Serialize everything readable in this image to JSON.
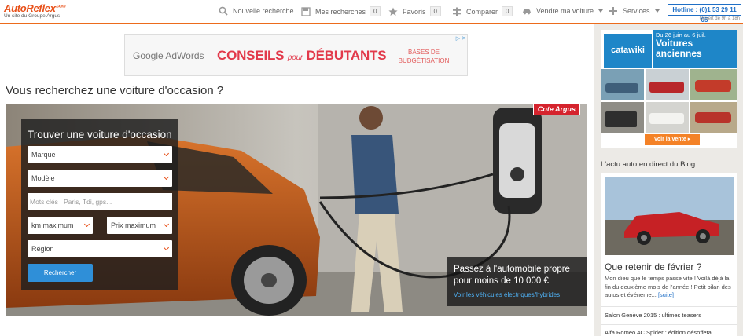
{
  "header": {
    "brand": "AutoReflex",
    "brand_sup": ".com",
    "tagline": "Un site du Groupe Argus",
    "nav": [
      {
        "label": "Nouvelle recherche",
        "icon": "search-icon"
      },
      {
        "label": "Mes recherches",
        "icon": "saved-search-icon",
        "count": "0"
      },
      {
        "label": "Favoris",
        "icon": "star-icon",
        "count": "0"
      },
      {
        "label": "Comparer",
        "icon": "compare-icon",
        "count": "0"
      },
      {
        "label": "Vendre ma voiture",
        "icon": "car-icon"
      },
      {
        "label": "Services",
        "icon": "plus-icon"
      }
    ],
    "hotline": "Hotline : (0)1 53 29 11 05",
    "hours": "Ouvert de 9h à 18h"
  },
  "ad": {
    "google": "Google AdWords",
    "conseils": "CONSEILS",
    "pour": "pour",
    "debutants": "DÉBUTANTS",
    "bases": "BASES DE BUDGÉTISATION",
    "close": "▷ ✕"
  },
  "main": {
    "title": "Vous recherchez une voiture d'occasion ?",
    "cote_badge": "Cote Argus",
    "search": {
      "heading": "Trouver une voiture d'occasion",
      "marque": "Marque",
      "modele": "Modèle",
      "keywords_placeholder": "Mots clés : Paris, Tdi, gps...",
      "km": "km maximum",
      "prix": "Prix maximum",
      "region": "Région",
      "submit": "Rechercher"
    },
    "promo": {
      "line": "Passez à l'automobile propre pour moins de 10 000 €",
      "link": "Voir les véhicules électriques/hybrides"
    }
  },
  "sidebar": {
    "catawiki": {
      "logo": "catawiki",
      "dates": "Du 26 juin au 6 juil.",
      "title1": "Voitures",
      "title2": "anciennes",
      "cta": "Voir la vente ▸"
    },
    "blog": {
      "heading": "L'actu auto en direct du Blog",
      "post_title": "Que retenir de février ?",
      "post_excerpt": "Mon dieu que le temps passe vite ! Voilà déjà la fin du deuxième mois de l'année ! Petit bilan des autos et événeme...",
      "more": "[suite]",
      "item1": "Salon Genève 2015 : ultimes teasers",
      "item2": "Alfa Romeo 4C Spider : édition désoffeta"
    }
  },
  "colors": {
    "accent": "#e8511a",
    "blue": "#2f8fd8",
    "argus_red": "#d5232d"
  }
}
